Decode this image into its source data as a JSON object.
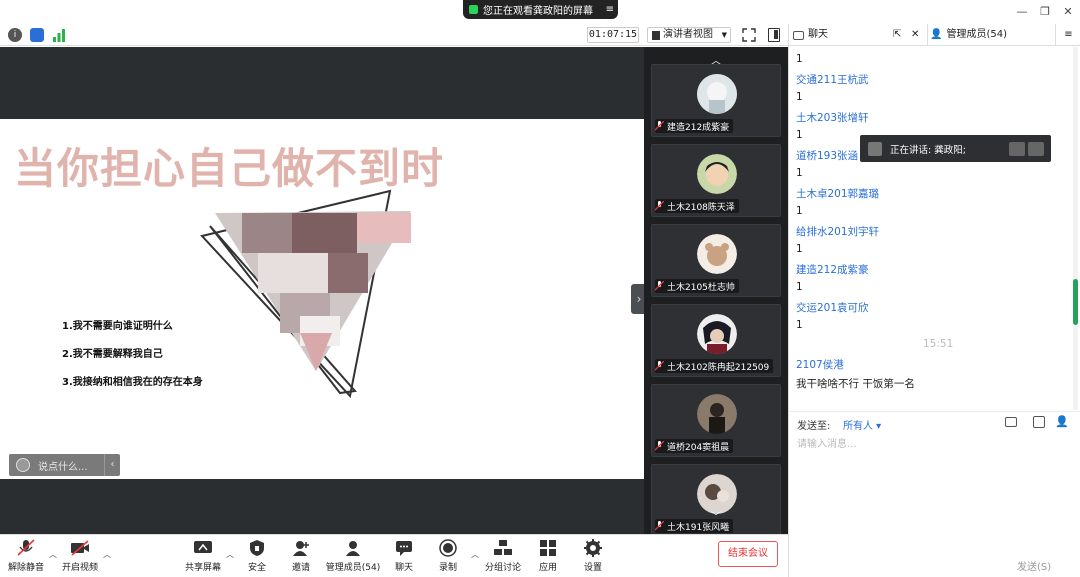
{
  "banner": {
    "text": "您正在观看龚政阳的屏幕"
  },
  "toolbar": {
    "timer": "01:07:15",
    "view_mode": "演讲者视图"
  },
  "slide": {
    "title": "当你担心自己做不到时",
    "points": [
      "1.我不需要向谁证明什么",
      "2.我不需要解释我自己",
      "3.我接纳和相信我在的存在本身"
    ],
    "say_placeholder": "说点什么..."
  },
  "videos": [
    {
      "name": "建造212成紫豪"
    },
    {
      "name": "土木2108陈天泽"
    },
    {
      "name": "土木2105杜志帅"
    },
    {
      "name": "土木2102陈冉起212509"
    },
    {
      "name": "道桥204窦祖晨"
    },
    {
      "name": "土木191张风曦"
    }
  ],
  "chat": {
    "tab_chat": "聊天",
    "tab_members": "管理成员(54)",
    "messages": [
      {
        "type": "text",
        "value": "1"
      },
      {
        "type": "name",
        "value": "交通211王杭武"
      },
      {
        "type": "text",
        "value": "1"
      },
      {
        "type": "name",
        "value": "土木203张增轩"
      },
      {
        "type": "text",
        "value": "1"
      },
      {
        "type": "name",
        "value": "道桥193张涵"
      },
      {
        "type": "text",
        "value": "1"
      },
      {
        "type": "name",
        "value": "土木卓201郭嘉璐"
      },
      {
        "type": "text",
        "value": "1"
      },
      {
        "type": "name",
        "value": "给排水201刘宇轩"
      },
      {
        "type": "text",
        "value": "1"
      },
      {
        "type": "name",
        "value": "建造212成紫豪"
      },
      {
        "type": "text",
        "value": "1"
      },
      {
        "type": "name",
        "value": "交运201袁可欣"
      },
      {
        "type": "text",
        "value": "1"
      },
      {
        "type": "time",
        "value": "15:51"
      },
      {
        "type": "name",
        "value": "2107侯港"
      },
      {
        "type": "text",
        "value": "我干啥啥不行 干饭第一名"
      }
    ],
    "speaking": "正在讲话: 龚政阳;",
    "send_to_label": "发送至:",
    "send_to_value": "所有人",
    "input_placeholder": "请输入消息...",
    "send_button": "发送(S)"
  },
  "bottom": {
    "unmute": "解除静音",
    "start_video": "开启视频",
    "share_screen": "共享屏幕",
    "security": "安全",
    "invite": "邀请",
    "members": "管理成员(54)",
    "chat": "聊天",
    "record": "录制",
    "breakout": "分组讨论",
    "apps": "应用",
    "settings": "设置",
    "end": "结束会议"
  },
  "colors": {
    "accent": "#2a6fd6",
    "end_red": "#e33333",
    "title_pink": "#e0b4ad"
  }
}
